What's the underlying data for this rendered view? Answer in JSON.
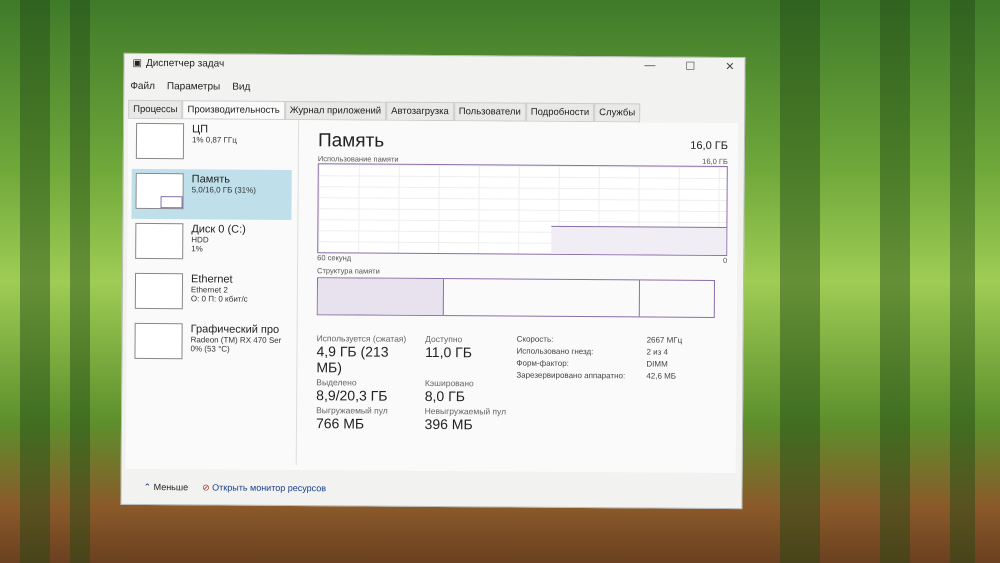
{
  "window": {
    "title": "Диспетчер задач"
  },
  "menu": [
    "Файл",
    "Параметры",
    "Вид"
  ],
  "tabs": [
    "Процессы",
    "Производительность",
    "Журнал приложений",
    "Автозагрузка",
    "Пользователи",
    "Подробности",
    "Службы"
  ],
  "sidebar": [
    {
      "name": "ЦП",
      "l1": "1% 0,87 ГГц",
      "l2": ""
    },
    {
      "name": "Память",
      "l1": "5,0/16,0 ГБ (31%)",
      "l2": ""
    },
    {
      "name": "Диск 0 (C:)",
      "l1": "HDD",
      "l2": "1%"
    },
    {
      "name": "Ethernet",
      "l1": "Ethernet 2",
      "l2": "О: 0 П: 0 кбит/с"
    },
    {
      "name": "Графический про",
      "l1": "Radeon (TM) RX 470 Ser",
      "l2": "0% (53 °C)"
    }
  ],
  "main": {
    "title": "Память",
    "total": "16,0 ГБ",
    "usage_label": "Использование памяти",
    "usage_max": "16,0 ГБ",
    "time_label": "60 секунд",
    "zero": "0",
    "structure_label": "Структура памяти",
    "usage_percent": 31,
    "stats": [
      {
        "label": "Используется (сжатая)",
        "value": "4,9 ГБ (213 МБ)"
      },
      {
        "label": "Доступно",
        "value": "11,0 ГБ"
      },
      {
        "label": "Выделено",
        "value": "8,9/20,3 ГБ"
      },
      {
        "label": "Кэшировано",
        "value": "8,0 ГБ"
      },
      {
        "label": "Выгружаемый пул",
        "value": "766 МБ"
      },
      {
        "label": "Невыгружаемый пул",
        "value": "396 МБ"
      }
    ],
    "props": [
      {
        "label": "Скорость:",
        "value": "2667 МГц"
      },
      {
        "label": "Использовано гнезд:",
        "value": "2 из 4"
      },
      {
        "label": "Форм-фактор:",
        "value": "DIMM"
      },
      {
        "label": "Зарезервировано аппаратно:",
        "value": "42,6 МБ"
      }
    ]
  },
  "footer": {
    "less": "Меньше",
    "monitor": "Открыть монитор ресурсов"
  }
}
